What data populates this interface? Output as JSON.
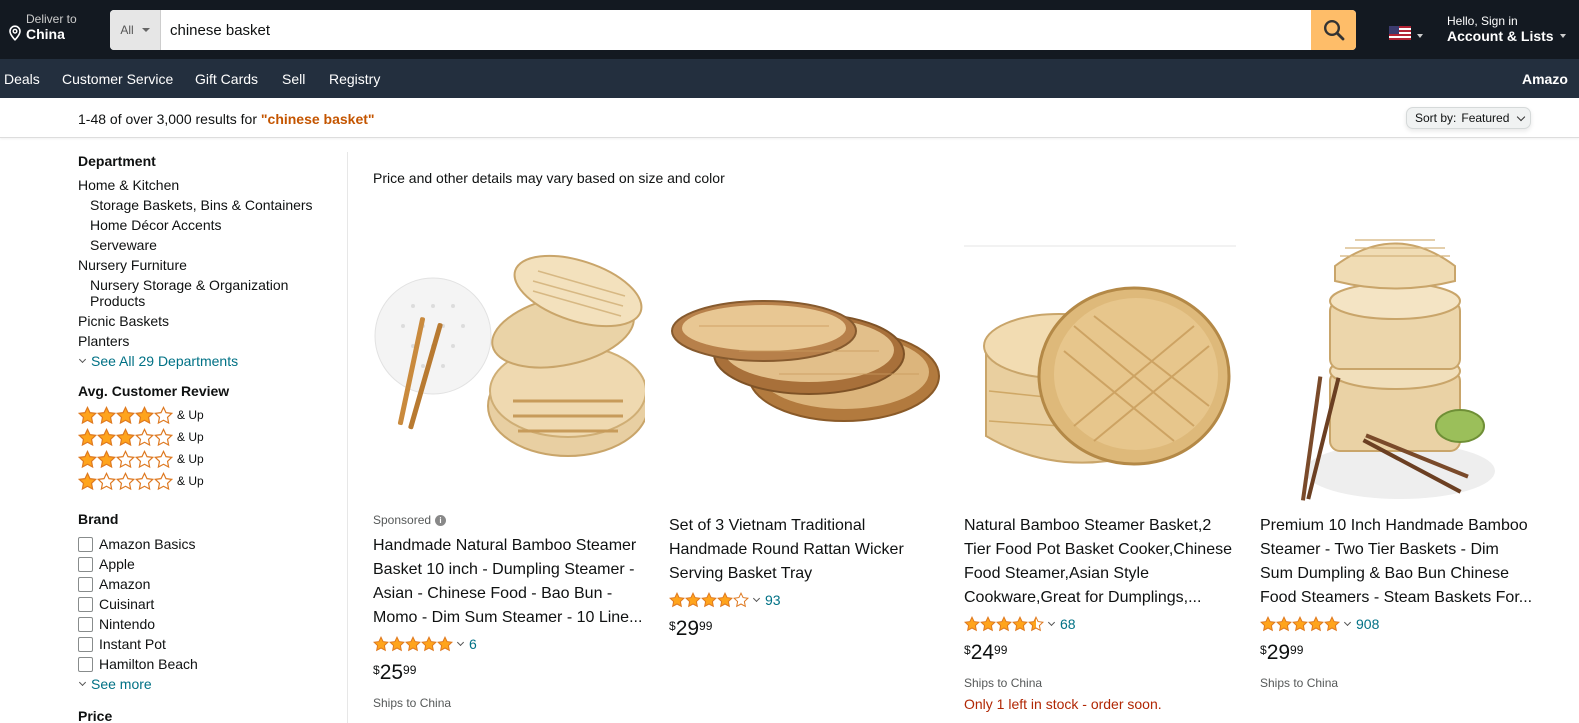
{
  "header": {
    "deliver_label": "Deliver to",
    "deliver_location": "China",
    "search_category": "All",
    "search_value": "chinese basket",
    "greeting": "Hello, Sign in",
    "account_label": "Account & Lists"
  },
  "subnav": {
    "items": [
      "Deals",
      "Customer Service",
      "Gift Cards",
      "Sell",
      "Registry"
    ],
    "right_label": "Amazo"
  },
  "results": {
    "count_text": "1-48 of over 3,000 results for",
    "query_text": "\"chinese basket\"",
    "sort_label": "Sort by:",
    "sort_value": "Featured"
  },
  "sidebar": {
    "department_heading": "Department",
    "departments": [
      {
        "label": "Home & Kitchen",
        "indent": false
      },
      {
        "label": "Storage Baskets, Bins & Containers",
        "indent": true
      },
      {
        "label": "Home Décor Accents",
        "indent": true
      },
      {
        "label": "Serveware",
        "indent": true
      },
      {
        "label": "Nursery Furniture",
        "indent": false
      },
      {
        "label": "Nursery Storage & Organization Products",
        "indent": true
      },
      {
        "label": "Picnic Baskets",
        "indent": false
      },
      {
        "label": "Planters",
        "indent": false
      }
    ],
    "see_all_departments": "See All 29 Departments",
    "review_heading": "Avg. Customer Review",
    "review_rows": [
      {
        "stars": 4,
        "label": "& Up"
      },
      {
        "stars": 3,
        "label": "& Up"
      },
      {
        "stars": 2,
        "label": "& Up"
      },
      {
        "stars": 1,
        "label": "& Up"
      }
    ],
    "brand_heading": "Brand",
    "brands": [
      "Amazon Basics",
      "Apple",
      "Amazon",
      "Cuisinart",
      "Nintendo",
      "Instant Pot",
      "Hamilton Beach"
    ],
    "see_more": "See more",
    "price_heading": "Price"
  },
  "main": {
    "note": "Price and other details may vary based on size and color",
    "sponsored_label": "Sponsored",
    "products": [
      {
        "title": "Handmade Natural Bamboo Steamer Basket 10 inch -  Dumpling Steamer - Asian - Chinese Food - Bao Bun - Momo - Dim Sum Steamer - 10 Line...",
        "sponsored": true,
        "rating": 5,
        "reviews": "6",
        "price_symbol": "$",
        "price_whole": "25",
        "price_fraction": "99",
        "ships": "Ships to China",
        "stock": ""
      },
      {
        "title": "Set of 3 Vietnam Traditional Handmade Round Rattan Wicker Serving Basket Tray",
        "sponsored": false,
        "rating": 4,
        "reviews": "93",
        "price_symbol": "$",
        "price_whole": "29",
        "price_fraction": "99",
        "ships": "",
        "stock": ""
      },
      {
        "title": "Natural Bamboo Steamer Basket,2 Tier Food Pot Basket Cooker,Chinese Food Steamer,Asian Style Cookware,Great for Dumplings,...",
        "sponsored": false,
        "rating": 4.5,
        "reviews": "68",
        "price_symbol": "$",
        "price_whole": "24",
        "price_fraction": "99",
        "ships": "Ships to China",
        "stock": "Only 1 left in stock - order soon."
      },
      {
        "title": "Premium 10 Inch Handmade Bamboo Steamer - Two Tier Baskets - Dim Sum Dumpling & Bao Bun Chinese Food Steamers - Steam Baskets For...",
        "sponsored": false,
        "rating": 5,
        "reviews": "908",
        "price_symbol": "$",
        "price_whole": "29",
        "price_fraction": "99",
        "ships": "Ships to China",
        "stock": ""
      }
    ]
  },
  "colors": {
    "nav_bg": "#131921",
    "subnav_bg": "#232f3e",
    "search_button": "#febd69",
    "link": "#007185",
    "query": "#c45500",
    "star": "#ffa41c",
    "stock": "#b12704"
  }
}
